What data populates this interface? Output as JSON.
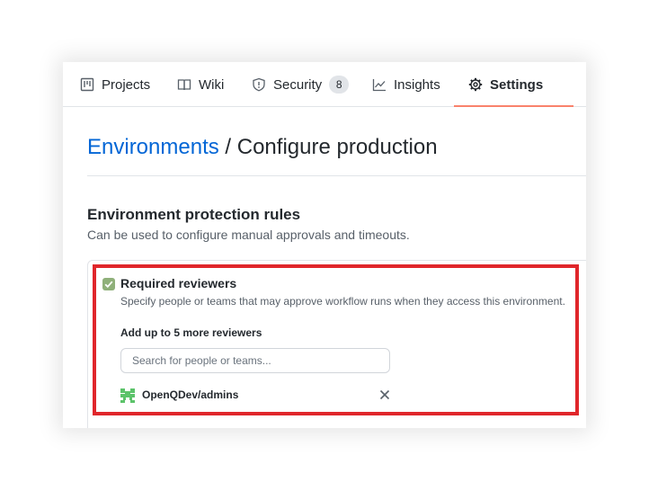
{
  "tabs": [
    {
      "label": "Projects",
      "icon": "project-board-icon"
    },
    {
      "label": "Wiki",
      "icon": "book-icon"
    },
    {
      "label": "Security",
      "icon": "shield-icon",
      "count": "8"
    },
    {
      "label": "Insights",
      "icon": "graph-icon"
    },
    {
      "label": "Settings",
      "icon": "gear-icon",
      "active": true
    }
  ],
  "heading": {
    "link": "Environments",
    "separator": " / ",
    "current": "Configure production"
  },
  "section": {
    "title": "Environment protection rules",
    "description": "Can be used to configure manual approvals and timeouts."
  },
  "required_reviewers": {
    "checked": true,
    "title": "Required reviewers",
    "description": "Specify people or teams that may approve workflow runs when they access this environment.",
    "add_label": "Add up to 5 more reviewers",
    "search_placeholder": "Search for people or teams...",
    "reviewers": [
      {
        "name": "OpenQDev/admins"
      }
    ]
  },
  "colors": {
    "link": "#0366d6",
    "active_tab_underline": "#f9826c",
    "highlight_frame": "#e0262b",
    "checkbox": "#8fb07a"
  }
}
